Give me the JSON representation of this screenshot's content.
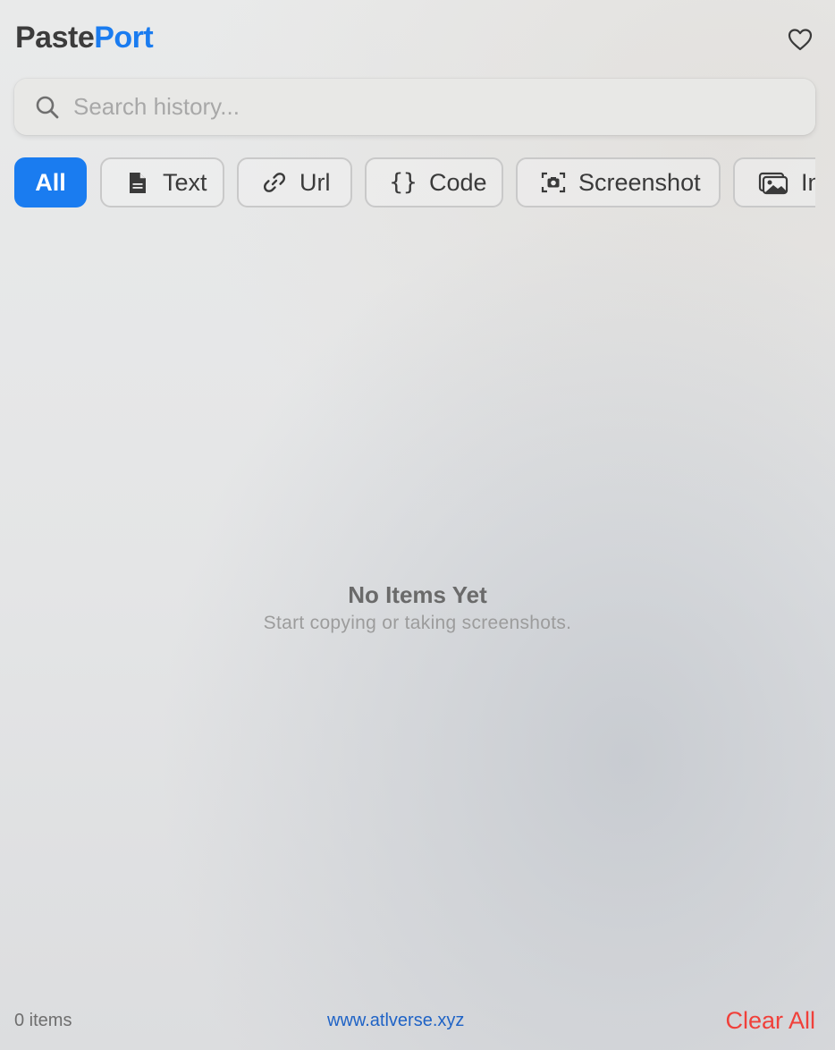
{
  "app": {
    "title_part1": "Paste",
    "title_part2": "Port"
  },
  "header": {
    "favorites_icon": "heart-icon"
  },
  "search": {
    "placeholder": "Search history...",
    "value": "",
    "icon": "search-icon"
  },
  "filters": [
    {
      "label": "All",
      "icon": null,
      "active": true
    },
    {
      "label": "Text",
      "icon": "document-text-icon",
      "active": false
    },
    {
      "label": "Url",
      "icon": "link-icon",
      "active": false
    },
    {
      "label": "Code",
      "icon": "braces-icon",
      "active": false
    },
    {
      "label": "Screenshot",
      "icon": "camera-viewfinder-icon",
      "active": false
    },
    {
      "label": "In",
      "icon": "photos-icon",
      "active": false
    }
  ],
  "empty_state": {
    "title": "No Items Yet",
    "subtitle": "Start copying or taking screenshots."
  },
  "footer": {
    "item_count": "0 items",
    "website": "www.atlverse.xyz",
    "clear_label": "Clear All"
  },
  "colors": {
    "accent": "#1a7cf0",
    "danger": "#f0403a",
    "link": "#1f63c6"
  }
}
